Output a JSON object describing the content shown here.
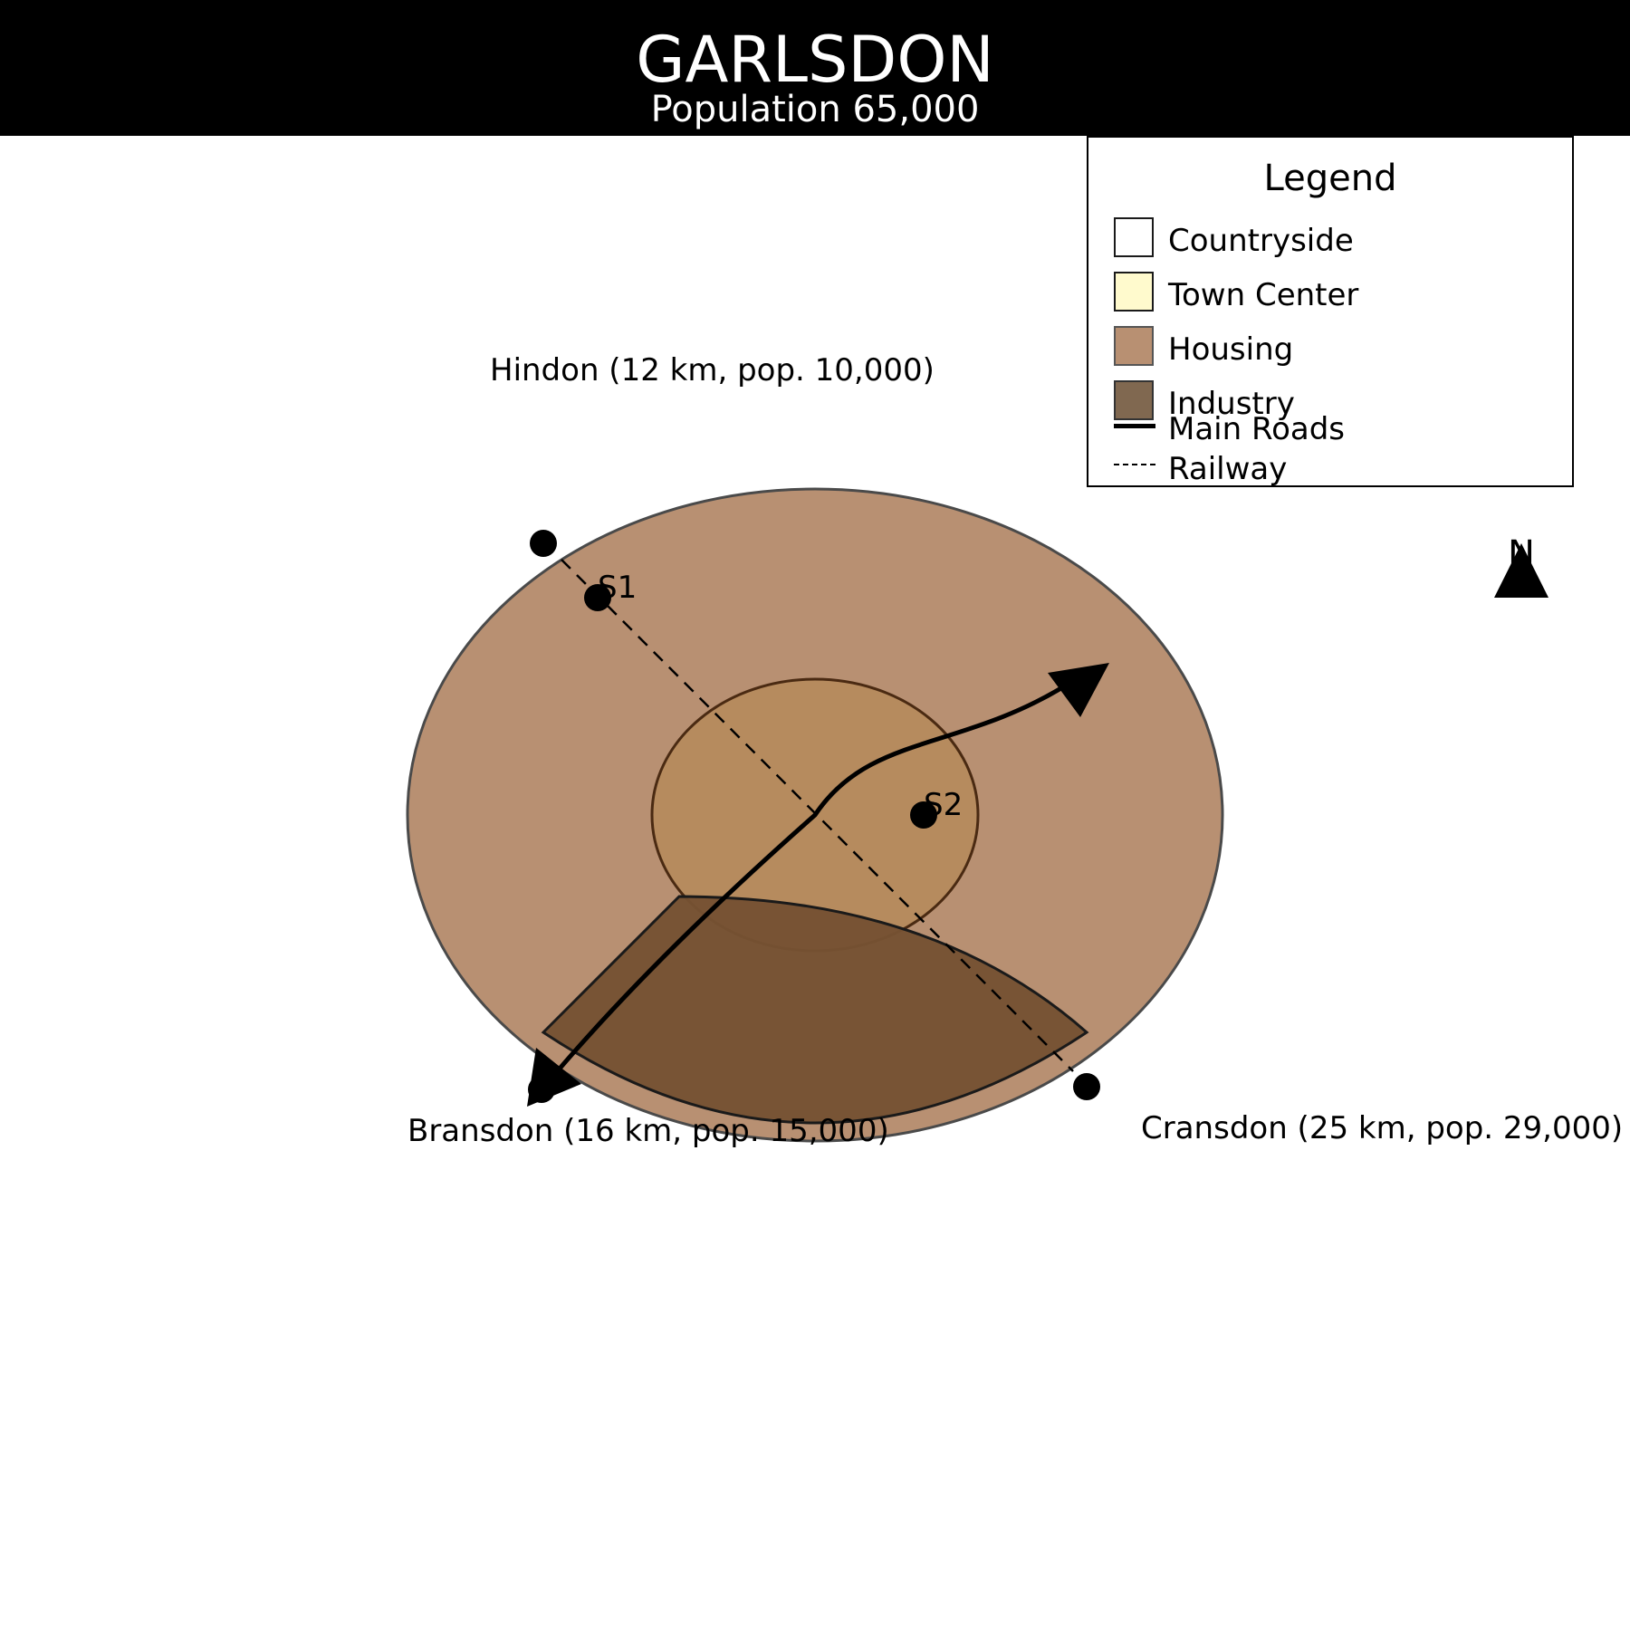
{
  "header": {
    "title": "GARLSDON",
    "subtitle": "Population 65,000"
  },
  "colors": {
    "countryside": "#ffffff",
    "town_center": "#fffacd",
    "housing": "#b89072",
    "industry": "#806850",
    "town_center_on_map": "#b68b5e",
    "industry_on_map": "#765233"
  },
  "legend": {
    "title": "Legend",
    "items": [
      {
        "label": "Countryside",
        "kind": "area",
        "color": "#ffffff"
      },
      {
        "label": "Town Center",
        "kind": "area",
        "color": "#fffacd"
      },
      {
        "label": "Housing",
        "kind": "area",
        "color": "#b89072"
      },
      {
        "label": "Industry",
        "kind": "area",
        "color": "#806850"
      },
      {
        "label": "Main Roads",
        "kind": "solid-line"
      },
      {
        "label": "Railway",
        "kind": "dashed-line"
      }
    ]
  },
  "map": {
    "north_label": "N",
    "stations": [
      {
        "label": "S1"
      },
      {
        "label": "S2"
      }
    ],
    "destinations": [
      {
        "label": "Hindon (12 km, pop. 10,000)"
      },
      {
        "label": "Bransdon (16 km, pop. 15,000)"
      },
      {
        "label": "Cransdon (25 km, pop. 29,000)"
      }
    ]
  }
}
